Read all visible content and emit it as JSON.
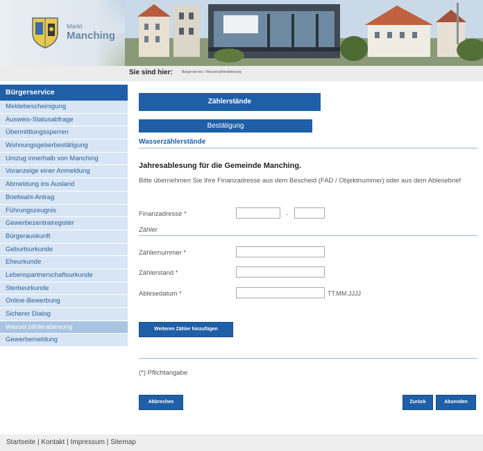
{
  "header": {
    "logo_markt": "Markt",
    "logo_name": "Manching"
  },
  "breadcrumb": {
    "label": "Sie sind hier:",
    "path": "Bürgerservice / Wasserzählerablesung"
  },
  "sidebar": {
    "title": "Bürgerservice",
    "items": [
      {
        "label": "Meldebescheinigung",
        "active": false
      },
      {
        "label": "Ausweis-Statusabfrage",
        "active": false
      },
      {
        "label": "Übermittlungssperren",
        "active": false
      },
      {
        "label": "Wohnungsgeberbestätigung",
        "active": false
      },
      {
        "label": "Umzug innerhalb von Manching",
        "active": false
      },
      {
        "label": "Voranzeige einer Anmeldung",
        "active": false
      },
      {
        "label": "Abmeldung ins Ausland",
        "active": false
      },
      {
        "label": "Briefwahl-Antrag",
        "active": false
      },
      {
        "label": "Führungszeugnis",
        "active": false
      },
      {
        "label": "Gewerbezentralregister",
        "active": false
      },
      {
        "label": "Bürgerauskunft",
        "active": false
      },
      {
        "label": "Geburtsurkunde",
        "active": false
      },
      {
        "label": "Eheurkunde",
        "active": false
      },
      {
        "label": "Lebenspartnerschaftsurkunde",
        "active": false
      },
      {
        "label": "Sterbeurkunde",
        "active": false
      },
      {
        "label": "Online-Bewerbung",
        "active": false
      },
      {
        "label": "Sicherer Dialog",
        "active": false
      },
      {
        "label": "Wasserzählerablesung",
        "active": true
      },
      {
        "label": "Gewerbemeldung",
        "active": false
      }
    ]
  },
  "main": {
    "title": "Zählerstände",
    "confirm_tab": "Bestätigung",
    "section_label": "Wasserzählerstände",
    "headline": "Jahresablesung für die Gemeinde Manching.",
    "intro": "Bitte übernehmen Sie Ihre Finanzadresse aus dem Bescheid (FAD / Objektnummer) oder aus dem Ablesebrief",
    "finanzadresse_label": "Finanzadresse *",
    "finanzadresse_sep": "-",
    "finanzadresse_part1": "",
    "finanzadresse_part2": "",
    "group_label": "Zähler",
    "zaehlernummer_label": "Zählernummer *",
    "zaehlernummer_value": "",
    "zaehlerstand_label": "Zählerstand *",
    "zaehlerstand_value": "",
    "ablesedatum_label": "Ablesedatum *",
    "ablesedatum_value": "",
    "date_hint": "TT.MM.JJJJ",
    "add_meter_button": "Weiteren Zähler hinzufügen",
    "required_note": "(*) Pflichtangabe",
    "cancel_button": "Abbrechen",
    "back_button": "Zurück",
    "submit_button": "Absenden"
  },
  "footer": {
    "links": [
      "Startseite",
      "Kontakt",
      "Impressum",
      "Sitemap"
    ],
    "separator": "|"
  },
  "colors": {
    "accent": "#1f5fa8",
    "sidebar_item_bg": "#d7e5f4",
    "sidebar_active_bg": "#a9c4e2"
  }
}
